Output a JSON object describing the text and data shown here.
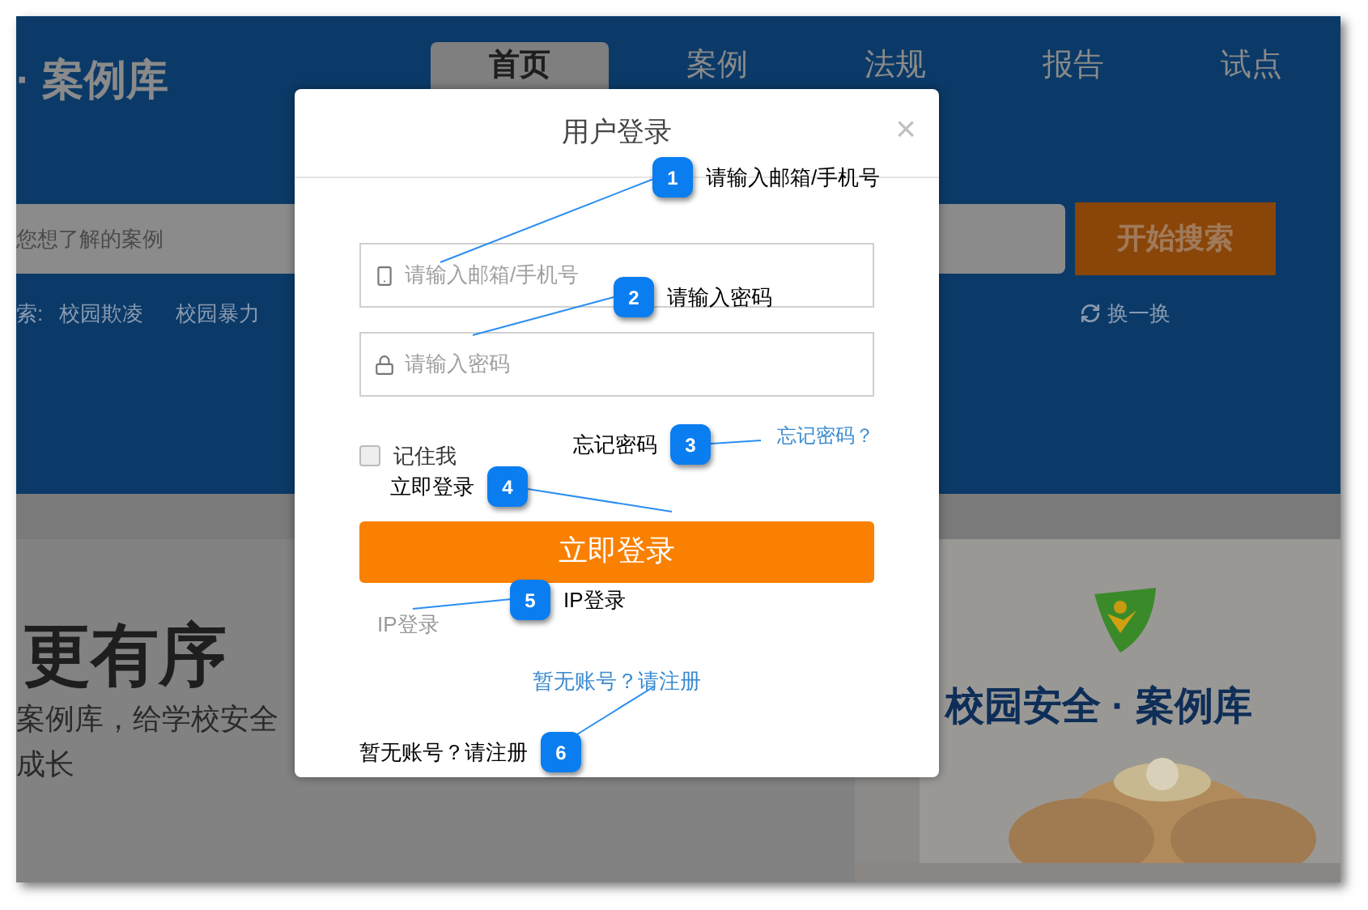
{
  "site": {
    "logo": "· 案例库",
    "nav": [
      {
        "label": "首页",
        "selected": true
      },
      {
        "label": "案例",
        "selected": false
      },
      {
        "label": "法规",
        "selected": false
      },
      {
        "label": "报告",
        "selected": false
      },
      {
        "label": "试点",
        "selected": false
      }
    ],
    "search": {
      "placeholder": "您想了解的案例",
      "button": "开始搜索"
    },
    "hot": {
      "label": "索:",
      "tags": [
        "校园欺凌",
        "校园暴力"
      ],
      "refresh": "换一换"
    },
    "banner": {
      "headline": "更有序",
      "lines": [
        "案例库，给学校安全",
        "成长"
      ],
      "brand": "校园安全 · 案例库"
    }
  },
  "dialog": {
    "title": "用户登录",
    "close": "×",
    "fields": [
      {
        "kind": "phone",
        "placeholder": "请输入邮箱/手机号"
      },
      {
        "kind": "lock",
        "placeholder": "请输入密码"
      }
    ],
    "remember": {
      "label": "记住我",
      "checked": false
    },
    "forgot": "忘记密码？",
    "submit": "立即登录",
    "ip_login": "IP登录",
    "register": "暂无账号？请注册"
  },
  "callouts": [
    {
      "number": "1",
      "text": "请输入邮箱/手机号"
    },
    {
      "number": "2",
      "text": "请输入密码"
    },
    {
      "number": "3",
      "text": "忘记密码"
    },
    {
      "number": "4",
      "text": "立即登录"
    },
    {
      "number": "5",
      "text": "IP登录"
    },
    {
      "number": "6",
      "text": "暂无账号？请注册"
    }
  ]
}
